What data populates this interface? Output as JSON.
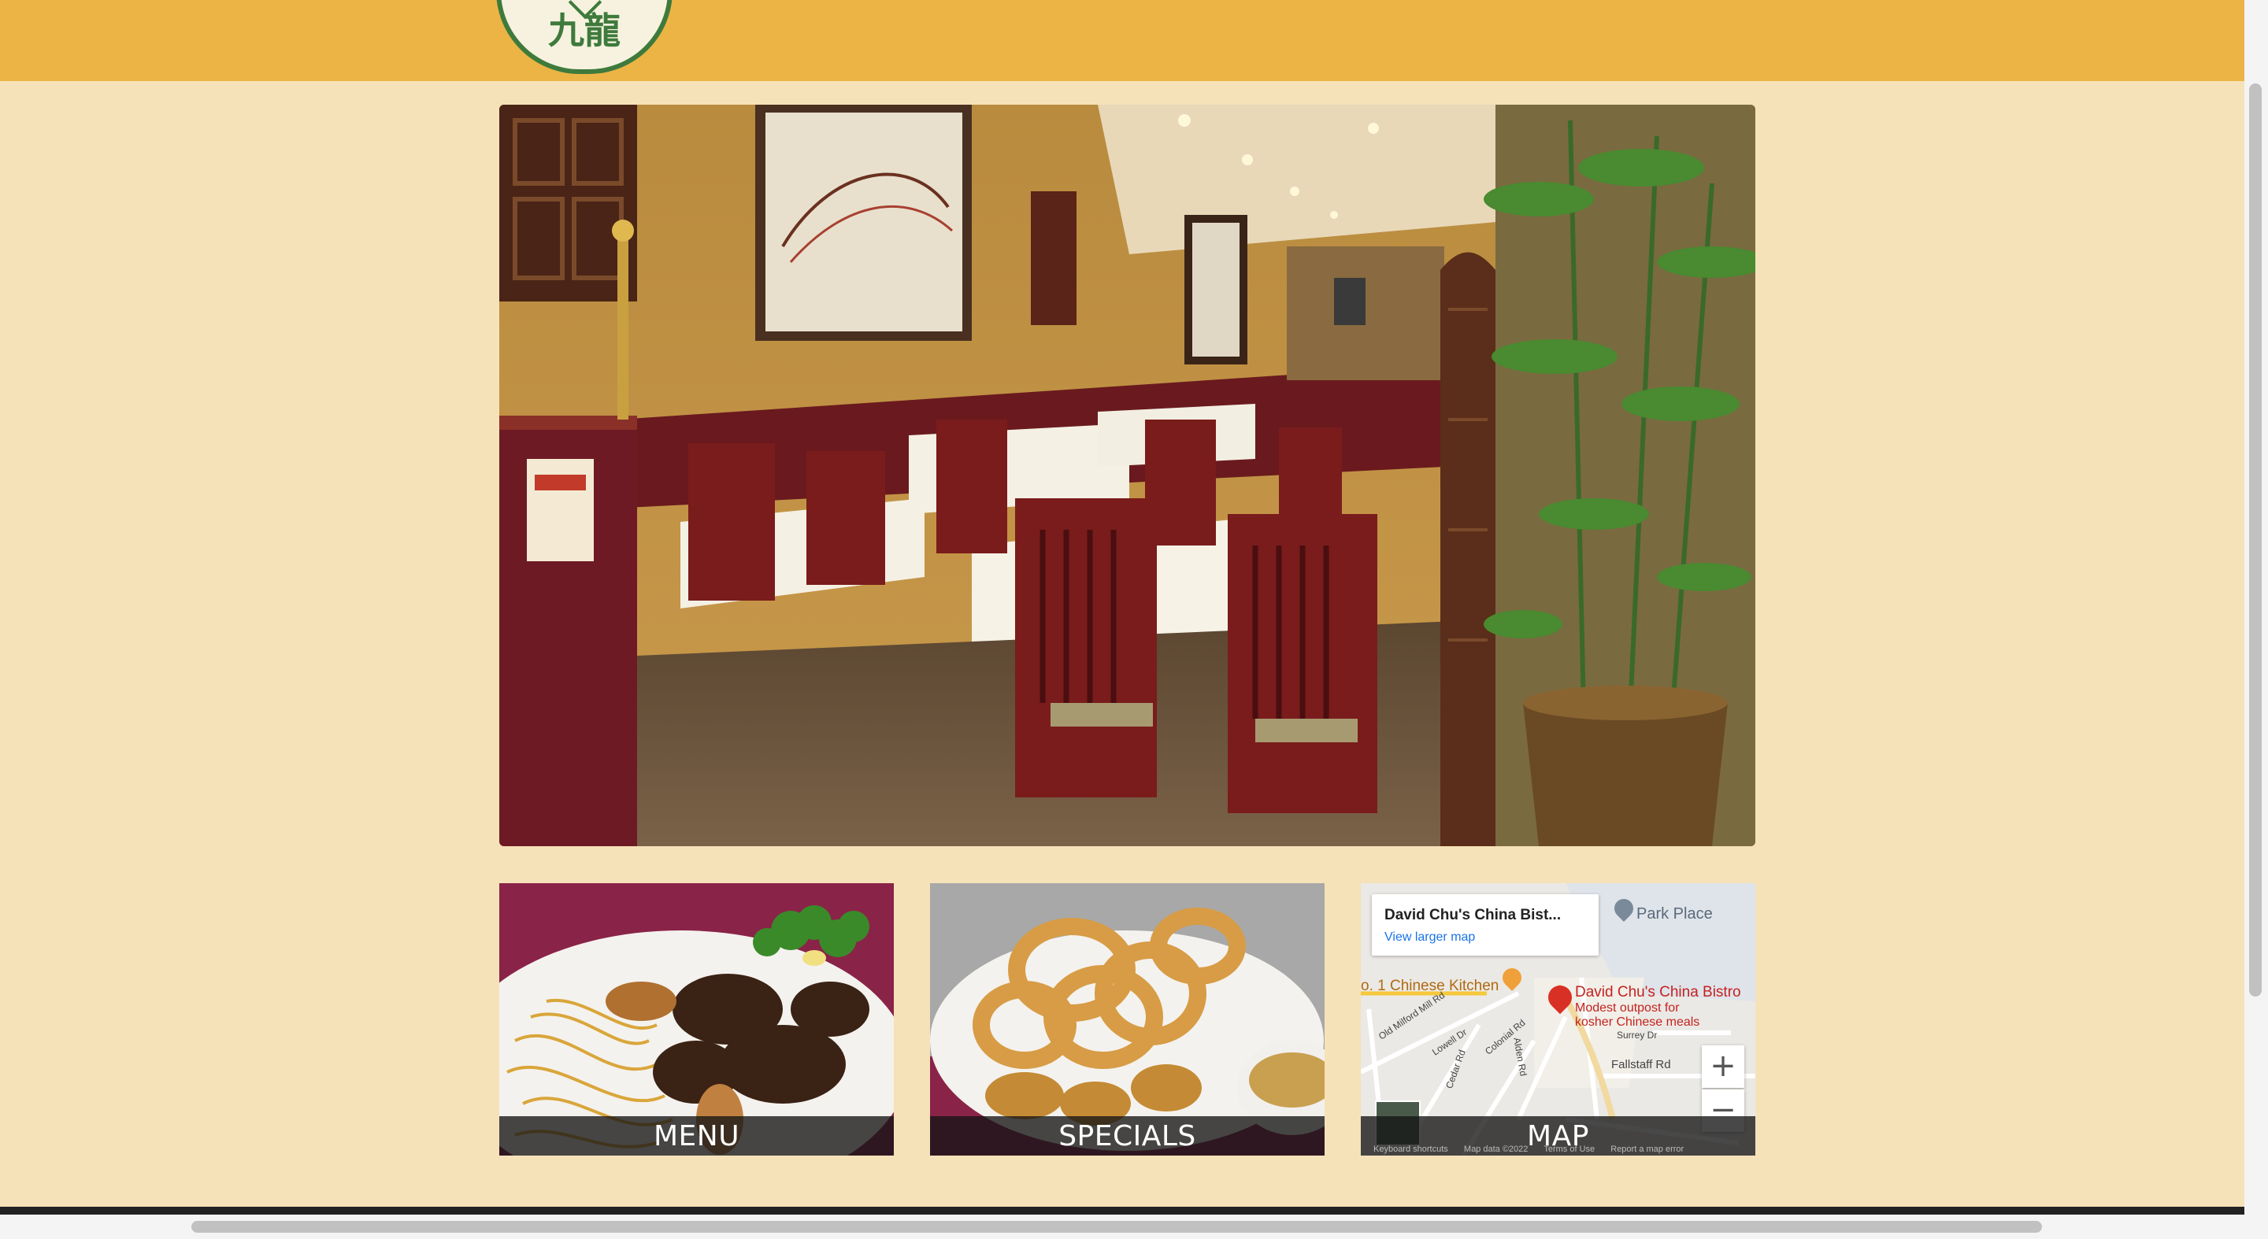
{
  "header": {
    "logo_text": "九龍",
    "colors": {
      "header_bg": "#ecb445",
      "logo_green": "#3e7a3c",
      "page_bg": "#f6e2b8"
    }
  },
  "hero": {
    "image": "restaurant-dining-room"
  },
  "tiles": [
    {
      "label": "MENU",
      "image": "lo-mein-and-sesame-chicken-plate"
    },
    {
      "label": "SPECIALS",
      "image": "fried-onion-rings-and-tempura-plate"
    },
    {
      "label": "MAP",
      "image": "google-map-embed"
    }
  ],
  "map": {
    "card_title": "David Chu's China Bist...",
    "card_link": "View larger map",
    "pin_title": "David Chu's China Bistro",
    "pin_desc_line1": "Modest outpost for",
    "pin_desc_line2": "kosher Chinese meals",
    "place_park": "Park Place",
    "place_kitchen": "o. 1 Chinese Kitchen",
    "roads": [
      "Old Milford Mill Rd",
      "Lowell Dr",
      "Colonial Rd",
      "Alden Rd",
      "Fallstaff Rd",
      "Surrey Dr",
      "Cedar Rd"
    ],
    "zoom_in": "+",
    "zoom_out": "−",
    "attribution": [
      "Keyboard shortcuts",
      "Map data ©2022",
      "Terms of Use",
      "Report a map error"
    ]
  }
}
